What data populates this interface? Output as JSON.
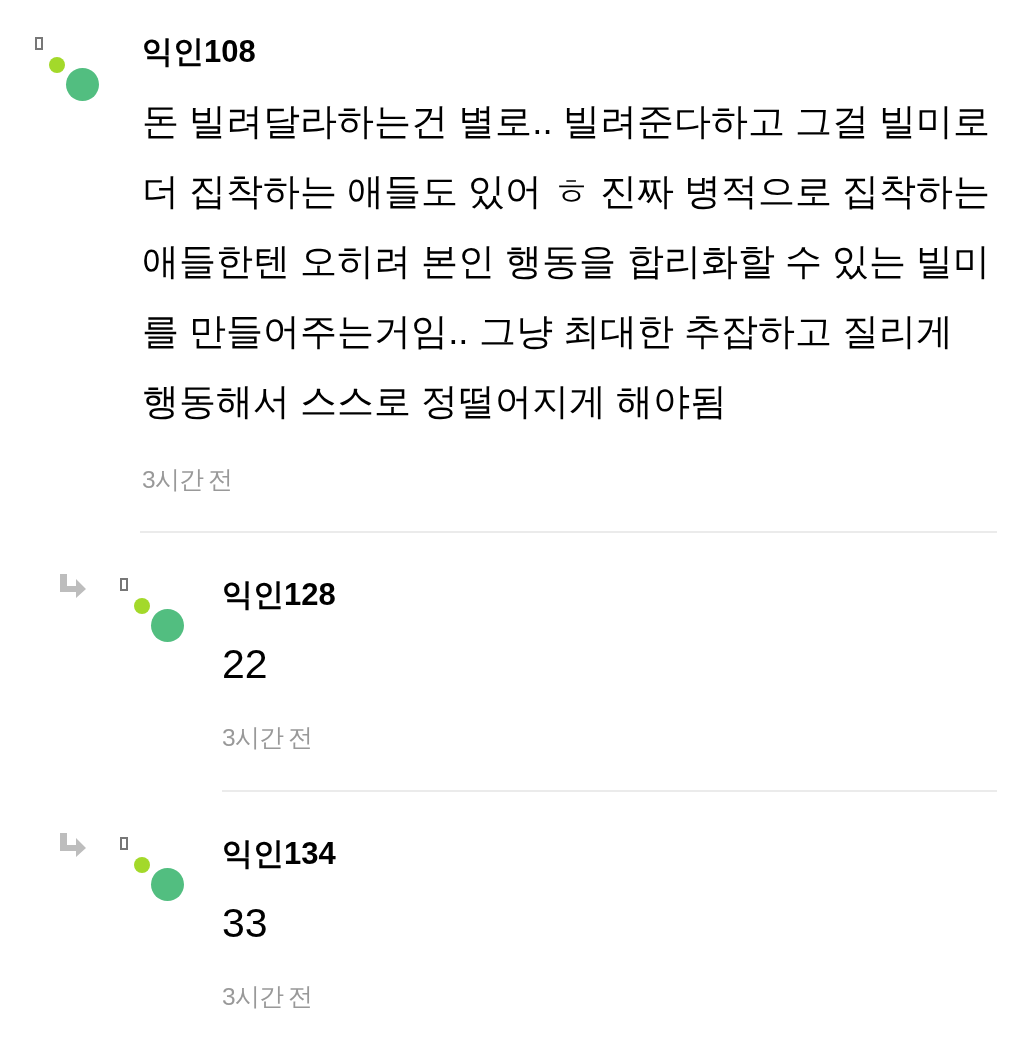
{
  "comments": [
    {
      "author": "익인108",
      "text": "돈 빌려달라하는건 별로.. 빌려준다하고 그걸 빌미로 더 집착하는 애들도 있어 ㅎ 진짜 병적으로 집착하는 애들한텐 오히려 본인 행동을 합리화할 수 있는 빌미를 만들어주는거임.. 그냥 최대한 추잡하고 질리게 행동해서 스스로 정떨어지게 해야됨",
      "time": "3시간 전",
      "replies": [
        {
          "author": "익인128",
          "text": "22",
          "time": "3시간 전"
        },
        {
          "author": "익인134",
          "text": "33",
          "time": "3시간 전"
        }
      ]
    }
  ]
}
